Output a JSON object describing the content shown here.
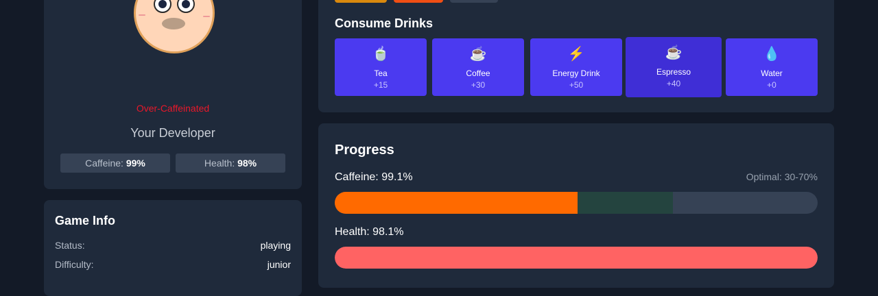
{
  "character": {
    "status": "Over-Caffeinated",
    "name": "Your Developer",
    "caffeine_label": "Caffeine:",
    "caffeine_value": "99%",
    "health_label": "Health:",
    "health_value": "98%"
  },
  "game_info": {
    "title": "Game Info",
    "rows": [
      {
        "key": "Status:",
        "value": "playing"
      },
      {
        "key": "Difficulty:",
        "value": "junior"
      }
    ]
  },
  "drinks": {
    "title": "Consume Drinks",
    "tab_colors": [
      "#d9890e",
      "#f04e14",
      "#364255"
    ],
    "items": [
      {
        "icon": "🍵",
        "icon_name": "tea-icon",
        "name": "Tea",
        "value": "+15"
      },
      {
        "icon": "☕",
        "icon_name": "coffee-icon",
        "name": "Coffee",
        "value": "+30"
      },
      {
        "icon": "⚡",
        "icon_name": "lightning-icon",
        "name": "Energy Drink",
        "value": "+50"
      },
      {
        "icon": "☕",
        "icon_name": "espresso-icon",
        "name": "Espresso",
        "value": "+40"
      },
      {
        "icon": "💧",
        "icon_name": "water-drop-icon",
        "name": "Water",
        "value": "+0"
      }
    ]
  },
  "progress": {
    "title": "Progress",
    "caffeine_label": "Caffeine: 99.1%",
    "optimal_label": "Optimal: 30-70%",
    "health_label": "Health: 98.1%",
    "caffeine_fill_fraction": 0.503,
    "health_fill_fraction": 1.0,
    "optimal_range": [
      0.503,
      0.7
    ],
    "colors": {
      "caffeine": "#ff6a00",
      "optimal_zone": "#24443f",
      "health": "#ff6363",
      "track": "#364255"
    }
  }
}
